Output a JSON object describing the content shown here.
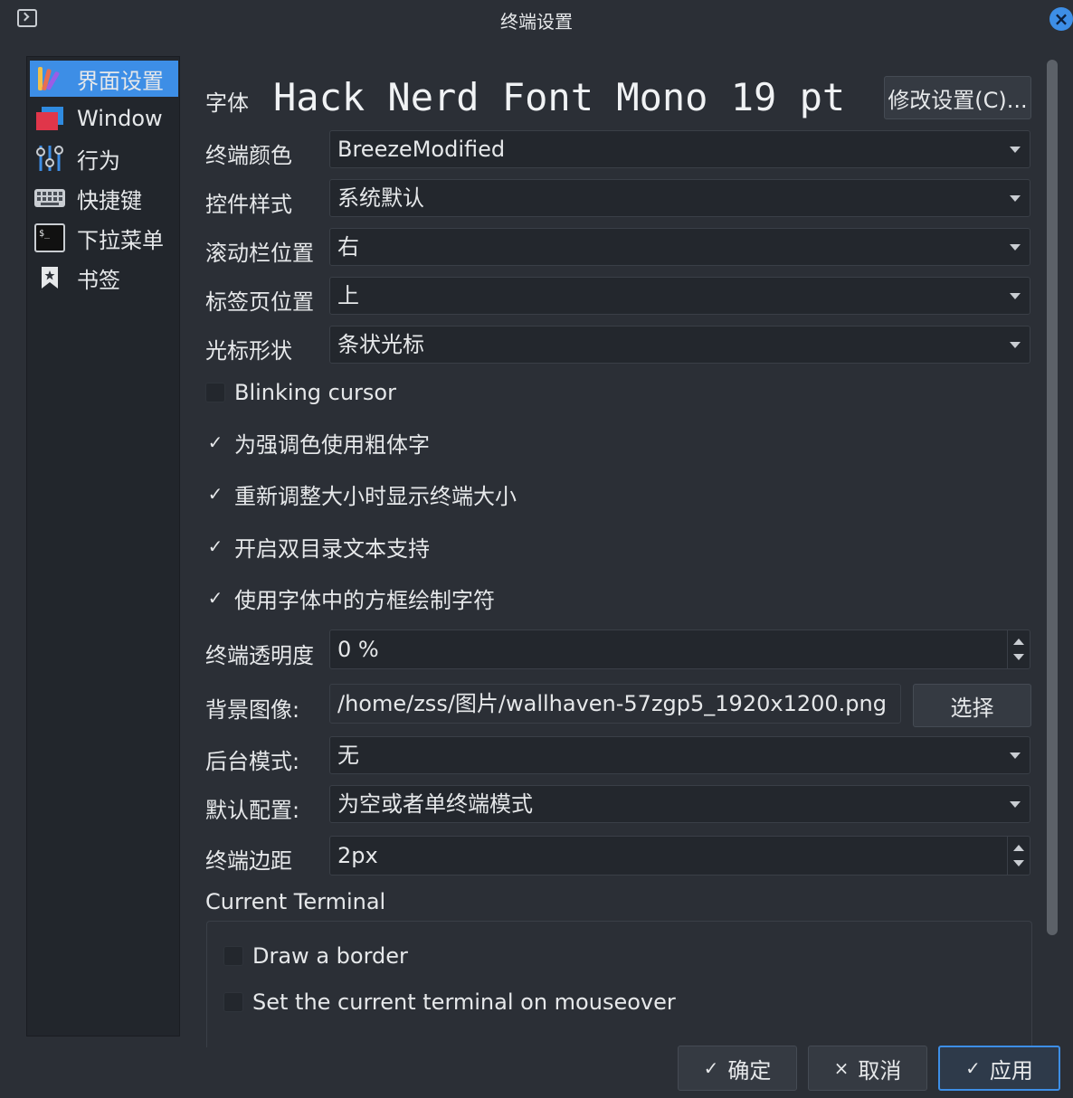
{
  "window": {
    "title": "终端设置",
    "close_glyph": "×"
  },
  "sidebar": {
    "items": [
      {
        "label": "界面设置",
        "icon": "appearance-icon",
        "active": true
      },
      {
        "label": "Window",
        "icon": "window-icon"
      },
      {
        "label": "行为",
        "icon": "behavior-icon"
      },
      {
        "label": "快捷键",
        "icon": "keyboard-icon"
      },
      {
        "label": "下拉菜单",
        "icon": "terminal-icon"
      },
      {
        "label": "书签",
        "icon": "bookmark-icon"
      }
    ]
  },
  "font": {
    "label": "字体",
    "display": "Hack Nerd Font Mono 19 pt",
    "change_button": "修改设置(C)..."
  },
  "fields": {
    "color_scheme": {
      "label": "终端颜色",
      "value": "BreezeModified"
    },
    "widget_style": {
      "label": "控件样式",
      "value": "系统默认"
    },
    "scrollbar_pos": {
      "label": "滚动栏位置",
      "value": "右"
    },
    "tab_pos": {
      "label": "标签页位置",
      "value": "上"
    },
    "cursor_shape": {
      "label": "光标形状",
      "value": "条状光标"
    },
    "opacity": {
      "label": "终端透明度",
      "value": "0 %"
    },
    "background_image": {
      "label": "背景图像:",
      "value": "/home/zss/图片/wallhaven-57zgp5_1920x1200.png",
      "button": "选择"
    },
    "backend_mode": {
      "label": "后台模式:",
      "value": "无"
    },
    "default_profile": {
      "label": "默认配置:",
      "value": "为空或者单终端模式"
    },
    "margin": {
      "label": "终端边距",
      "value": "2px"
    }
  },
  "checkboxes": {
    "blinking_cursor": {
      "label": "Blinking cursor",
      "checked": false
    },
    "bold_intense": {
      "label": "为强调色使用粗体字",
      "checked": true
    },
    "show_size": {
      "label": "重新调整大小时显示终端大小",
      "checked": true
    },
    "bidi": {
      "label": "开启双目录文本支持",
      "checked": true
    },
    "box_drawing": {
      "label": "使用字体中的方框绘制字符",
      "checked": true
    }
  },
  "current_terminal": {
    "title": "Current Terminal",
    "draw_border": {
      "label": "Draw a border",
      "checked": false
    },
    "focus_mouseover": {
      "label": "Set the current terminal on mouseover",
      "checked": false
    }
  },
  "check_glyph": "✓",
  "buttons": {
    "ok": {
      "label": "确定",
      "glyph": "✓"
    },
    "cancel": {
      "label": "取消",
      "glyph": "×"
    },
    "apply": {
      "label": "应用",
      "glyph": "✓"
    }
  },
  "colors": {
    "accent": "#3d8ee6",
    "background": "#2b2f36",
    "field": "#23272d"
  }
}
